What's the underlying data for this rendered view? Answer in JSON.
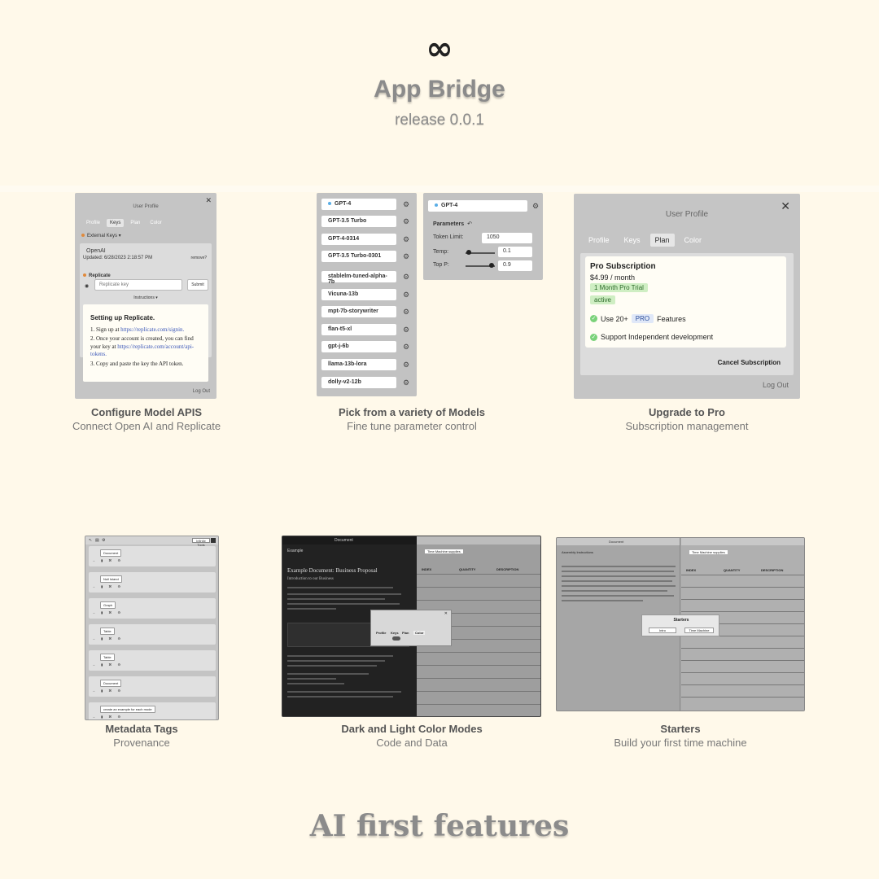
{
  "header": {
    "logo_glyph": "∞",
    "title": "App Bridge",
    "release": "release 0.0.1"
  },
  "features": [
    {
      "title": "Configure Model APIS",
      "subtitle": "Connect Open AI and Replicate",
      "panel": {
        "title": "User Profile",
        "tabs": [
          "Profile",
          "Keys",
          "Plan",
          "Color"
        ],
        "active_tab": "Keys",
        "external_keys": "External Keys ▾",
        "openai_label": "OpenAI",
        "updated": "Updated: 6/28/2023 2:18:57 PM",
        "remove": "remove?",
        "replicate_label": "Replicate",
        "replicate_placeholder": "Replicate key",
        "submit": "Submit",
        "instructions": "Instructions ▾",
        "setup_title": "Setting up Replicate.",
        "step1_prefix": "1. Sign up at",
        "step1_link": "https://replicate.com/signin.",
        "step2_text": "2. Once your account is created, you can find your key at",
        "step2_link": "https://replicate.com/account/api-tokens.",
        "step3": "3. Copy and paste the key the API token.",
        "logout": "Log Out"
      }
    },
    {
      "title": "Pick from a variety of Models",
      "subtitle": "Fine tune parameter control",
      "models": [
        "GPT-4",
        "GPT-3.5 Turbo",
        "GPT-4-0314",
        "GPT-3.5 Turbo-0301",
        "stablelm-tuned-alpha-7b",
        "Vicuna-13b",
        "mpt-7b-storywriter",
        "flan-t5-xl",
        "gpt-j-6b",
        "llama-13b-lora",
        "dolly-v2-12b"
      ],
      "params": {
        "model": "GPT-4",
        "title": "Parameters",
        "back": "↶",
        "token_limit_label": "Token Limit:",
        "token_limit": "1050",
        "temp_label": "Temp:",
        "temp": "0.1",
        "temp_fraction": 0.1,
        "top_p_label": "Top P:",
        "top_p": "0.9",
        "top_p_fraction": 0.9
      }
    },
    {
      "title": "Upgrade to Pro",
      "subtitle": "Subscription management",
      "panel": {
        "title": "User Profile",
        "tabs": [
          "Profile",
          "Keys",
          "Plan",
          "Color"
        ],
        "active_tab": "Plan",
        "plan_title": "Pro Subscription",
        "price": "$4.99 / month",
        "trial": "1 Month Pro Trial",
        "status": "active",
        "feature1_prefix": "Use 20+",
        "feature1_badge": "PRO",
        "feature1_suffix": "Features",
        "feature2": "Support Independent development",
        "cancel": "Cancel Subscription",
        "logout": "Log Out"
      }
    },
    {
      "title": "Metadata Tags",
      "subtitle": "Provenance",
      "tags": [
        "Document",
        "Null Island",
        "Graph",
        "Table",
        "Table",
        "Document",
        "create an example for each mode"
      ],
      "infinite": "Infinite Tools"
    },
    {
      "title": "Dark and Light Color Modes",
      "subtitle": "Code and Data",
      "window_title": "Document",
      "doc_tab": "Example",
      "doc_title": "Example Document: Business Proposal",
      "doc_subtitle": "Introduction to our Business",
      "table_title": "Time Machine supplies",
      "table_headers": [
        "INDEX",
        "QUANTITY",
        "DESCRIPTION"
      ],
      "modal_tabs": [
        "Profile",
        "Keys",
        "Plan",
        "Color"
      ]
    },
    {
      "title": "Starters",
      "subtitle": "Build your first time machine",
      "window_title": "Document",
      "doc_tab": "Assembly Instructions",
      "modal_title": "Starters",
      "modal_buttons": [
        "Intro",
        "Time Machine"
      ],
      "table_title": "Time Machine supplies",
      "table_headers": [
        "INDEX",
        "QUANTITY",
        "DESCRIPTION"
      ]
    }
  ],
  "footer": {
    "title": "AI first features"
  },
  "colors": {
    "background": "#fff9ea",
    "card_gray": "#c5c5c5",
    "active_green": "#cfeec3",
    "link_blue": "#3a56b8"
  }
}
